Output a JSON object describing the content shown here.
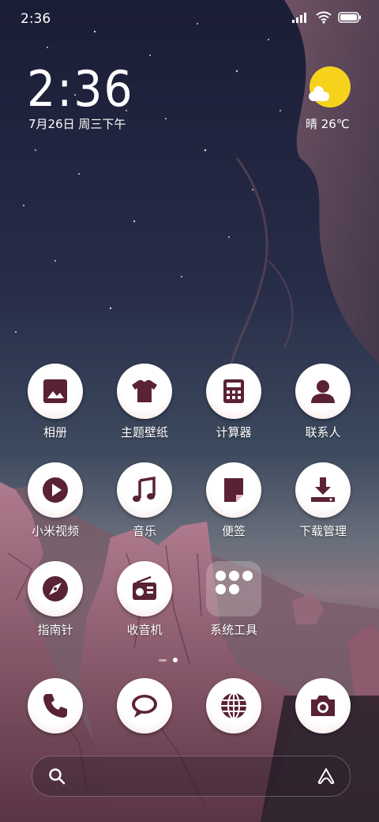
{
  "status_bar": {
    "time": "2:36"
  },
  "widget": {
    "clock": "2:36",
    "date": "7月26日 周三下午",
    "weather": "晴 26℃"
  },
  "apps": [
    {
      "label": "相册",
      "icon": "gallery-icon"
    },
    {
      "label": "主题壁纸",
      "icon": "tshirt-icon"
    },
    {
      "label": "计算器",
      "icon": "calculator-icon"
    },
    {
      "label": "联系人",
      "icon": "contacts-icon"
    },
    {
      "label": "小米视频",
      "icon": "play-icon"
    },
    {
      "label": "音乐",
      "icon": "music-note-icon"
    },
    {
      "label": "便签",
      "icon": "note-icon"
    },
    {
      "label": "下载管理",
      "icon": "download-icon"
    },
    {
      "label": "指南针",
      "icon": "compass-icon"
    },
    {
      "label": "收音机",
      "icon": "radio-icon"
    },
    {
      "label": "系统工具",
      "icon": "folder-icon"
    }
  ],
  "dock": [
    {
      "icon": "phone-icon"
    },
    {
      "icon": "message-icon"
    },
    {
      "icon": "browser-globe-icon"
    },
    {
      "icon": "camera-icon"
    }
  ],
  "colors": {
    "icon_fg": "#5a2236",
    "sun": "#f7d21c",
    "sky_top": "#1c2038",
    "rock": "#c98a9c"
  }
}
